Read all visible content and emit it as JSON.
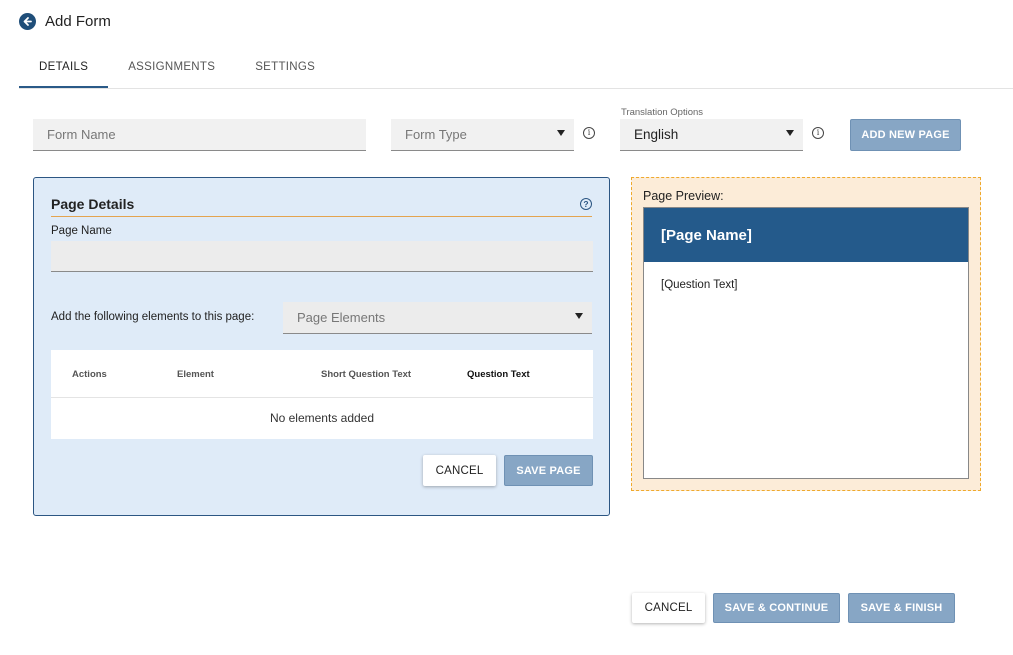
{
  "header": {
    "title": "Add Form"
  },
  "tabs": [
    "DETAILS",
    "ASSIGNMENTS",
    "SETTINGS"
  ],
  "form": {
    "name_placeholder": "Form Name",
    "type_placeholder": "Form Type",
    "translation_label": "Translation Options",
    "translation_value": "English",
    "add_page_label": "ADD NEW PAGE"
  },
  "page_details": {
    "title": "Page Details",
    "page_name_label": "Page Name",
    "elements_label": "Add the following elements to this page:",
    "elements_placeholder": "Page Elements",
    "table": {
      "columns": [
        "Actions",
        "Element",
        "Short Question Text",
        "Question Text"
      ],
      "empty_text": "No elements added"
    },
    "cancel_label": "CANCEL",
    "save_label": "SAVE PAGE"
  },
  "preview": {
    "label": "Page Preview:",
    "page_name": "[Page Name]",
    "question_text": "[Question Text]"
  },
  "footer": {
    "cancel_label": "CANCEL",
    "save_continue_label": "SAVE & CONTINUE",
    "save_finish_label": "SAVE & FINISH"
  },
  "icons": {
    "back": "arrow-left-circle-icon",
    "info": "info-icon",
    "help": "question-circle-icon",
    "dropdown": "caret-down-icon"
  },
  "colors": {
    "primary": "#245a8b",
    "button_disabled": "#87a6c5",
    "panel_bg": "#dfebf8",
    "preview_bg": "#fcecd8",
    "accent_orange": "#efa92c"
  }
}
